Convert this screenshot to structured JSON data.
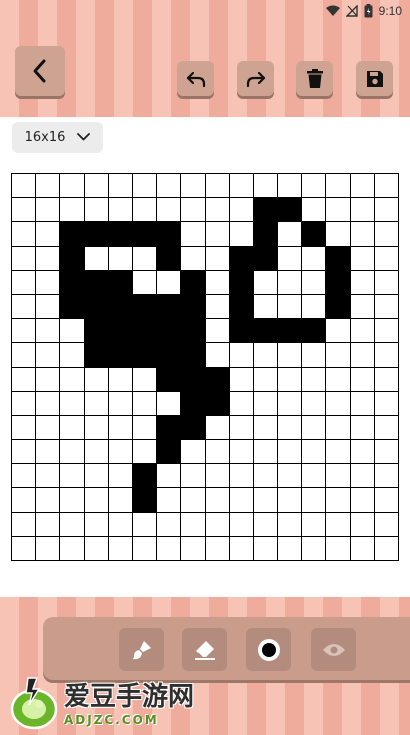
{
  "status_bar": {
    "time": "9:10"
  },
  "header": {
    "buttons": [
      {
        "id": "back",
        "icon": "chevron-left-icon"
      },
      {
        "id": "undo",
        "icon": "undo-icon"
      },
      {
        "id": "redo",
        "icon": "redo-icon"
      },
      {
        "id": "delete",
        "icon": "trash-icon"
      },
      {
        "id": "save",
        "icon": "save-icon"
      }
    ]
  },
  "grid_size": {
    "selected": "16x16"
  },
  "canvas": {
    "cols": 16,
    "rows": 16,
    "filled": [
      [
        10,
        1
      ],
      [
        11,
        1
      ],
      [
        2,
        2
      ],
      [
        3,
        2
      ],
      [
        4,
        2
      ],
      [
        5,
        2
      ],
      [
        6,
        2
      ],
      [
        10,
        2
      ],
      [
        12,
        2
      ],
      [
        2,
        3
      ],
      [
        6,
        3
      ],
      [
        9,
        3
      ],
      [
        10,
        3
      ],
      [
        13,
        3
      ],
      [
        2,
        4
      ],
      [
        3,
        4
      ],
      [
        4,
        4
      ],
      [
        7,
        4
      ],
      [
        9,
        4
      ],
      [
        13,
        4
      ],
      [
        2,
        5
      ],
      [
        3,
        5
      ],
      [
        4,
        5
      ],
      [
        5,
        5
      ],
      [
        6,
        5
      ],
      [
        7,
        5
      ],
      [
        9,
        5
      ],
      [
        13,
        5
      ],
      [
        3,
        6
      ],
      [
        4,
        6
      ],
      [
        5,
        6
      ],
      [
        6,
        6
      ],
      [
        7,
        6
      ],
      [
        9,
        6
      ],
      [
        10,
        6
      ],
      [
        11,
        6
      ],
      [
        12,
        6
      ],
      [
        3,
        7
      ],
      [
        4,
        7
      ],
      [
        5,
        7
      ],
      [
        6,
        7
      ],
      [
        7,
        7
      ],
      [
        6,
        8
      ],
      [
        7,
        8
      ],
      [
        8,
        8
      ],
      [
        7,
        9
      ],
      [
        8,
        9
      ],
      [
        6,
        10
      ],
      [
        7,
        10
      ],
      [
        6,
        11
      ],
      [
        5,
        12
      ],
      [
        5,
        13
      ]
    ],
    "colors": {
      "filled": "#000000",
      "empty": "#ffffff",
      "lines": "#000000"
    }
  },
  "tools": [
    {
      "id": "brush",
      "icon": "brush-icon"
    },
    {
      "id": "eraser",
      "icon": "eraser-icon"
    },
    {
      "id": "color",
      "icon": "color-dot-icon"
    },
    {
      "id": "preview",
      "icon": "eye-icon"
    }
  ],
  "watermark": {
    "cn": "爱豆手游网",
    "en": "ADJZC.COM"
  },
  "theme": {
    "stripe_light": "#f7c3b5",
    "stripe_dark": "#efab9c",
    "button": "#cfa392"
  }
}
